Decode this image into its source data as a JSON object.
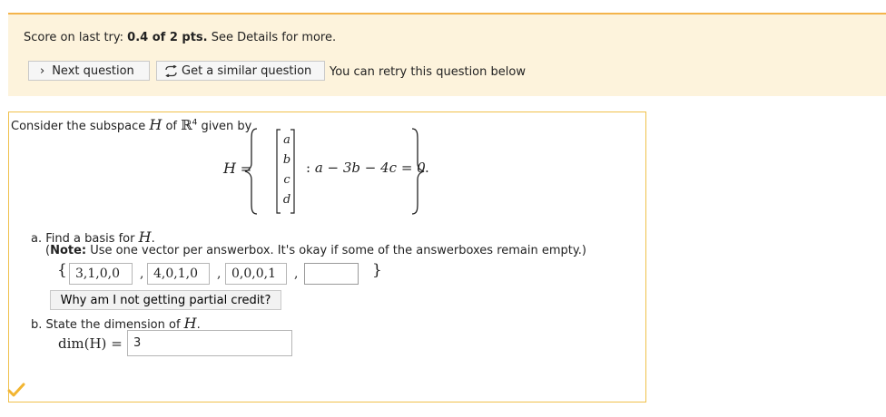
{
  "banner": {
    "score_prefix": "Score on last try: ",
    "score_value": "0.4 of 2 pts.",
    "score_suffix": " See Details for more.",
    "next_label": "Next question",
    "similar_label": "Get a similar question",
    "retry_text": "You can retry this question below"
  },
  "question": {
    "intro_prefix": "Consider the subspace ",
    "intro_var": "H",
    "intro_of": " of ",
    "intro_space": "ℝ",
    "intro_exp": "4",
    "intro_suffix": " given by",
    "set_lhs": "H",
    "set_eq": " =",
    "vector": [
      "a",
      "b",
      "c",
      "d"
    ],
    "condition_colon": ":",
    "condition": "a − 3b − 4c = 0",
    "period": ".",
    "part_a_prefix": "a. Find a basis for ",
    "part_a_var": "H",
    "part_a_suffix": ".",
    "note_bold": "Note:",
    "note_rest": " Use one vector per answerbox. It's okay if some of the answerboxes remain empty.)",
    "note_open": "(",
    "brace_open": "{",
    "brace_close": "}",
    "answers": [
      "3,1,0,0",
      "4,0,1,0",
      "0,0,0,1",
      ""
    ],
    "comma": ",",
    "why_label": "Why am I not getting partial credit?",
    "part_b_prefix": "b. State the dimension of ",
    "part_b_var": "H",
    "part_b_suffix": ".",
    "dim_label": "dim(H)",
    "dim_eq": " =",
    "dim_value": "3"
  },
  "colors": {
    "banner_bg": "#fdf3dc",
    "banner_border": "#f4b44b",
    "question_border": "#f0c14b",
    "check": "#f2b531"
  },
  "icons": {
    "next": "chevron-right-icon",
    "similar": "retry-arrows-icon",
    "status": "checkmark-icon"
  }
}
